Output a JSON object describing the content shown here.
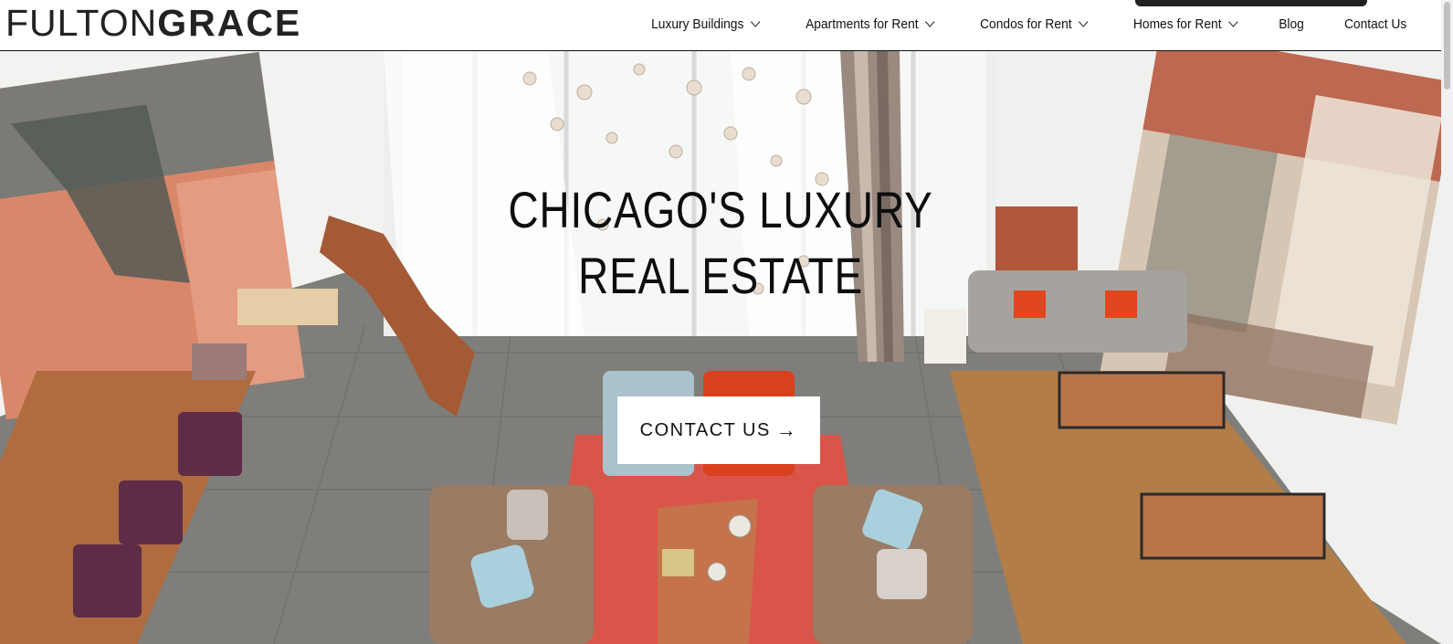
{
  "header": {
    "logo_part1": "FULTON",
    "logo_part2": "GRACE",
    "nav": [
      {
        "label": "Luxury Buildings",
        "has_dropdown": true
      },
      {
        "label": "Apartments for Rent",
        "has_dropdown": true
      },
      {
        "label": "Condos for Rent",
        "has_dropdown": true
      },
      {
        "label": "Homes for Rent",
        "has_dropdown": true
      },
      {
        "label": "Blog",
        "has_dropdown": false
      },
      {
        "label": "Contact Us",
        "has_dropdown": false
      }
    ]
  },
  "hero": {
    "title_line1": "CHICAGO'S LUXURY",
    "title_line2": "REAL ESTATE",
    "cta_label": "CONTACT US",
    "cta_arrow": "→"
  },
  "colors": {
    "text": "#111111",
    "header_bg": "#ffffff",
    "floor": "#7d7c78",
    "rug_red": "#d9584b",
    "rug_brown": "#b07a45"
  }
}
